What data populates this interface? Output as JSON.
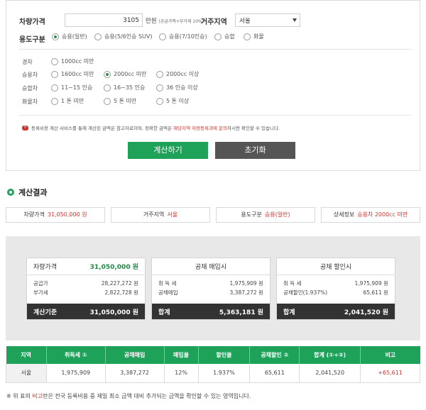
{
  "form": {
    "price_label": "차량가격",
    "price_value": "3105",
    "price_unit": "만원",
    "price_note": "(공급가액+부가세 10%)",
    "region_label": "거주지역",
    "region_value": "서울",
    "usage_label": "용도구분",
    "usage_options": [
      "승용(일반)",
      "승용(5/6인승 SUV)",
      "승용(7/10인승)",
      "승합",
      "화물"
    ],
    "usage_selected": 0,
    "sub_groups": [
      {
        "label": "경차",
        "options": [
          "1000cc 미만"
        ]
      },
      {
        "label": "승용차",
        "options": [
          "1600cc 미만",
          "2000cc 미만",
          "2000cc 이상"
        ],
        "selected": 1
      },
      {
        "label": "승합차",
        "options": [
          "11~15 인승",
          "16~35 인승",
          "36 인승 이상"
        ]
      },
      {
        "label": "화물차",
        "options": [
          "1 톤 미만",
          "5 톤 미만",
          "5 톤 이상"
        ]
      }
    ],
    "notice_badge": "!!",
    "notice_text_a": "등록비용 계산 서비스를 통해 계산된 금액은 참고자료이며, 정확한 금액은 ",
    "notice_text_red": "해당지역 차량등록과에 문의",
    "notice_text_b": "하시면 확인할 수 있습니다.",
    "calc_button": "계산하기",
    "reset_button": "초기화"
  },
  "result": {
    "title": "계산결과",
    "summary": [
      {
        "label": "차량가격",
        "value": "31,050,000 원"
      },
      {
        "label": "거주지역",
        "value": "서울"
      },
      {
        "label": "용도구분",
        "value": "승용(일반)"
      },
      {
        "label": "상세정보",
        "value": "승용차 2000cc 미만"
      }
    ],
    "card1": {
      "head_label": "차량가격",
      "head_value": "31,050,000 원",
      "rows": [
        [
          "공급가",
          "28,227,272 원"
        ],
        [
          "부가세",
          "2,822,728 원"
        ]
      ],
      "foot_label": "계산기준",
      "foot_value": "31,050,000 원"
    },
    "card2": {
      "head_label": "공채 매입시",
      "rows": [
        [
          "취 득 세",
          "1,975,909 원"
        ],
        [
          "공채매입",
          "3,387,272 원"
        ]
      ],
      "foot_label": "합계",
      "foot_value": "5,363,181 원"
    },
    "card3": {
      "head_label": "공채 할인시",
      "rows": [
        [
          "취 득 세",
          "1,975,909 원"
        ],
        [
          "공채할인(1.937%)",
          "65,611 원"
        ]
      ],
      "foot_label": "합계",
      "foot_value": "2,041,520 원"
    }
  },
  "table": {
    "headers": [
      "지역",
      "취득세 ①",
      "공채매입",
      "매입율",
      "할인율",
      "공채할인 ②",
      "합계 (①+②)",
      "비고"
    ],
    "row": [
      "서울",
      "1,975,909",
      "3,387,272",
      "12%",
      "1.937%",
      "65,611",
      "2,041,520",
      "+65,611"
    ]
  },
  "footnote": {
    "a": "※ 위 표의 ",
    "red": "비고",
    "b": "란은 전국 등록비용 중 제일 최소 금액 대비 추가되는 금액을 확인할 수 있는 영역입니다."
  },
  "colors": {
    "accent": "#1ea25a",
    "alert": "#d0332d",
    "dark": "#333333"
  }
}
